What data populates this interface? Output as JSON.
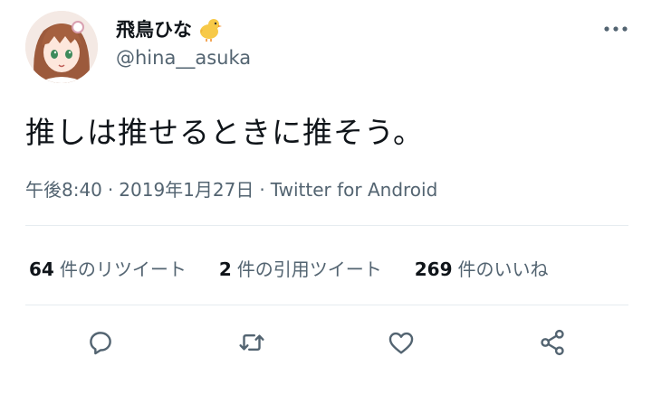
{
  "user": {
    "display_name": "飛鳥ひな",
    "handle": "@hina__asuka",
    "emoji_icon": "baby-chick-icon"
  },
  "tweet": {
    "text": "推しは推せるときに推そう。",
    "time": "午後8:40",
    "separator": "·",
    "date": "2019年1月27日",
    "source": "Twitter for Android"
  },
  "stats": {
    "retweets_count": "64",
    "retweets_label": "件のリツイート",
    "quotes_count": "2",
    "quotes_label": "件の引用ツイート",
    "likes_count": "269",
    "likes_label": "件のいいね"
  },
  "actions": [
    "reply-icon",
    "retweet-icon",
    "like-icon",
    "share-icon"
  ],
  "colors": {
    "text_primary": "#0f1419",
    "text_secondary": "#536471",
    "divider": "#e6ecf0",
    "icon": "#536471"
  }
}
